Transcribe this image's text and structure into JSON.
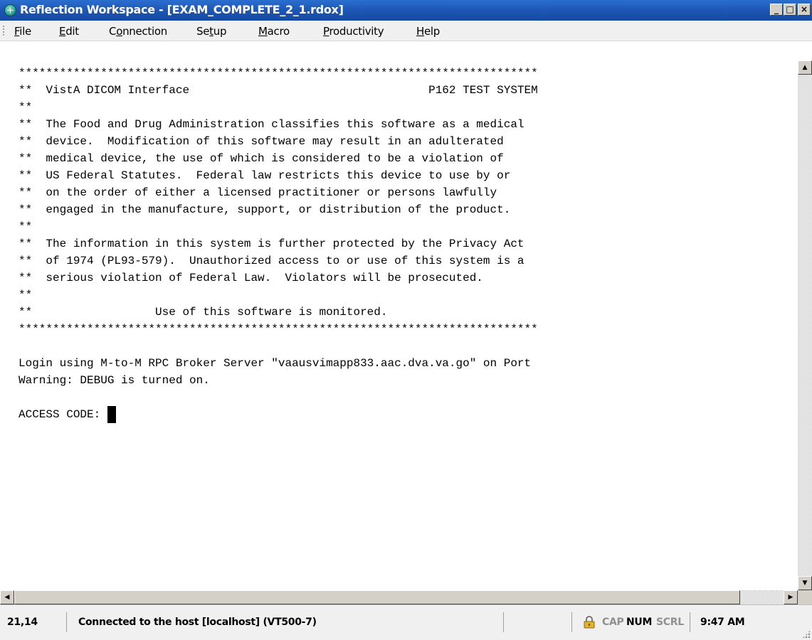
{
  "window": {
    "title": "Reflection Workspace - [EXAM_COMPLETE_2_1.rdox]",
    "controls": {
      "minimize": "_",
      "maximize": "□",
      "close": "×"
    }
  },
  "menu": {
    "items": [
      {
        "prefix": "",
        "underline": "F",
        "rest": "ile"
      },
      {
        "prefix": "",
        "underline": "E",
        "rest": "dit"
      },
      {
        "prefix": "C",
        "underline": "o",
        "rest": "nnection"
      },
      {
        "prefix": "Se",
        "underline": "t",
        "rest": "up"
      },
      {
        "prefix": "",
        "underline": "M",
        "rest": "acro"
      },
      {
        "prefix": "",
        "underline": "P",
        "rest": "roductivity"
      },
      {
        "prefix": "",
        "underline": "H",
        "rest": "elp"
      }
    ]
  },
  "terminal": {
    "lines": [
      "****************************************************************************",
      "**  VistA DICOM Interface                                   P162 TEST SYSTEM",
      "**",
      "**  The Food and Drug Administration classifies this software as a medical",
      "**  device.  Modification of this software may result in an adulterated",
      "**  medical device, the use of which is considered to be a violation of",
      "**  US Federal Statutes.  Federal law restricts this device to use by or",
      "**  on the order of either a licensed practitioner or persons lawfully",
      "**  engaged in the manufacture, support, or distribution of the product.",
      "**",
      "**  The information in this system is further protected by the Privacy Act",
      "**  of 1974 (PL93-579).  Unauthorized access to or use of this system is a",
      "**  serious violation of Federal Law.  Violators will be prosecuted.",
      "**",
      "**                  Use of this software is monitored.",
      "****************************************************************************",
      "",
      "Login using M-to-M RPC Broker Server \"vaausvimapp833.aac.dva.va.go\" on Port",
      "Warning: DEBUG is turned on.",
      "",
      "ACCESS CODE: "
    ]
  },
  "status": {
    "cursor_position": "21,14",
    "connection": "Connected to the host [localhost] (VT500-7)",
    "cap": "CAP",
    "num": "NUM",
    "scrl": "SCRL",
    "time": "9:47 AM"
  },
  "colors": {
    "titlebar": "#1d56b4",
    "lock_icon": "#d4a017"
  }
}
